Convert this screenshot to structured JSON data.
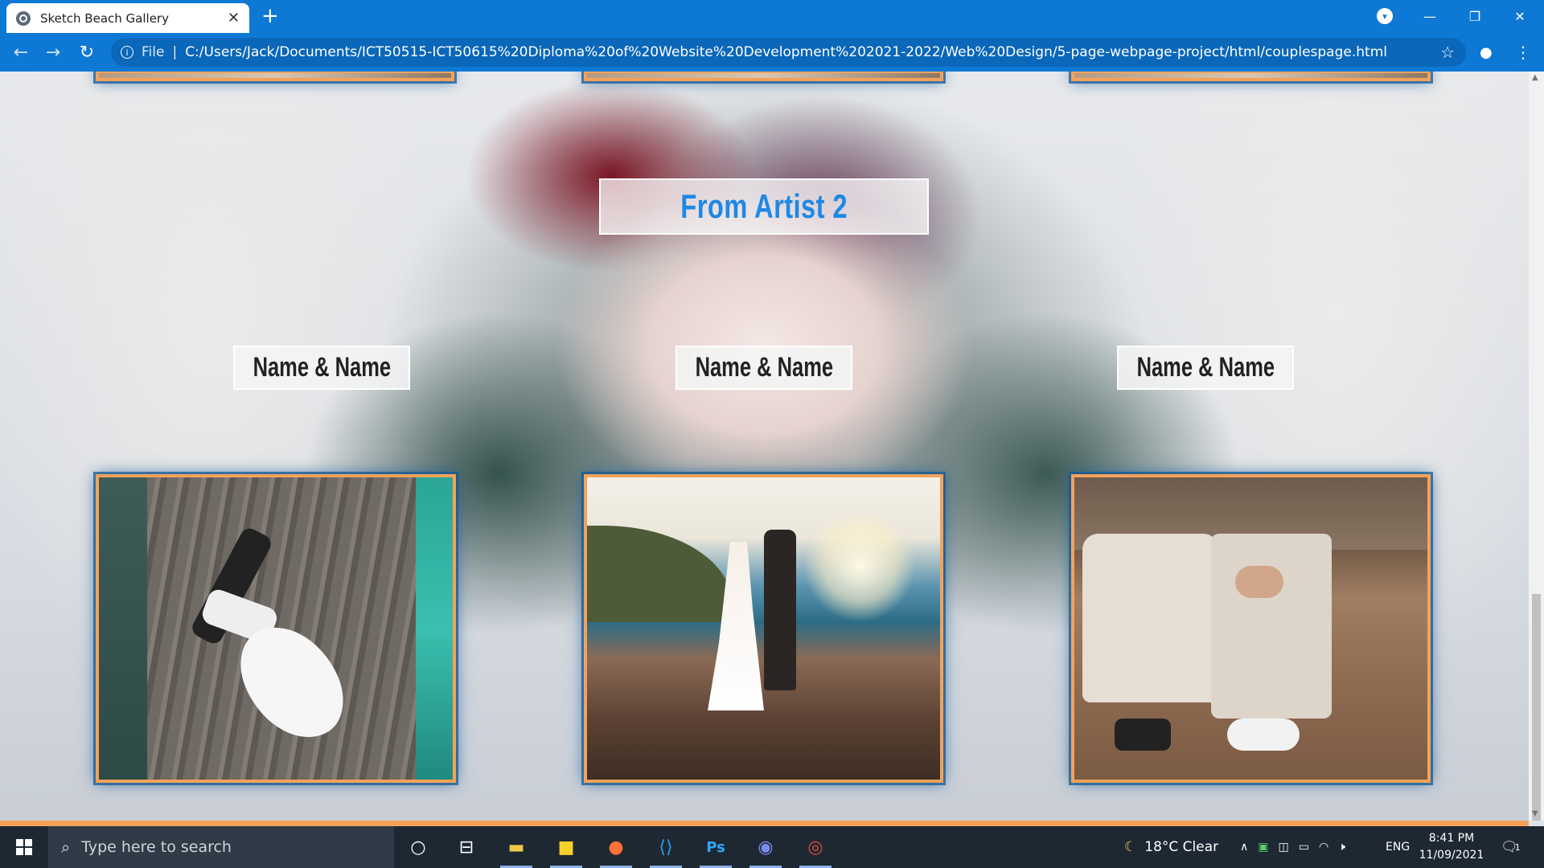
{
  "browser": {
    "tab_title": "Sketch Beach Gallery",
    "tab_close": "✕",
    "new_tab": "+",
    "file_label": "File",
    "url": "C:/Users/Jack/Documents/ICT50515-ICT50615%20Diploma%20of%20Website%20Development%202021-2022/Web%20Design/5-page-webpage-project/html/couplespage.html",
    "controls": {
      "minimize": "—",
      "restore": "❐",
      "close": "✕"
    }
  },
  "page": {
    "section_heading": "From Artist 2",
    "couples": [
      {
        "name": "Name & Name"
      },
      {
        "name": "Name & Name"
      },
      {
        "name": "Name & Name"
      }
    ],
    "colors": {
      "frame_border": "#f4a25a",
      "heading_text": "#1e88e5",
      "frame_glow": "#145a96"
    }
  },
  "taskbar": {
    "search_placeholder": "Type here to search",
    "weather": "18°C  Clear",
    "language": "ENG",
    "time": "8:41 PM",
    "date": "11/09/2021",
    "notification_count": "1",
    "pinned_apps": [
      "cortana-icon",
      "task-view-icon",
      "file-explorer-icon",
      "sticky-notes-icon",
      "firefox-icon",
      "vscode-icon",
      "photoshop-icon",
      "discord-icon",
      "chrome-icon"
    ],
    "photoshop_label": "Ps"
  }
}
